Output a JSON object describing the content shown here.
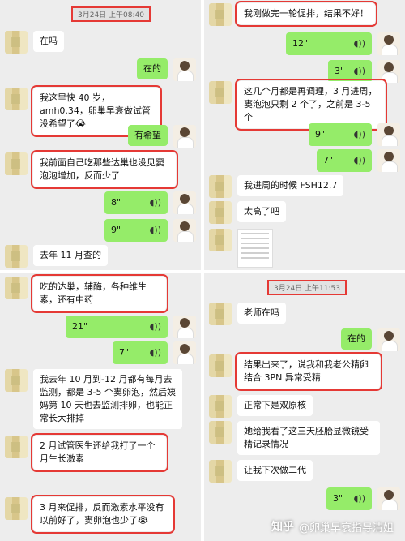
{
  "panel1": {
    "timestamp": "3月24日 上午08:40",
    "messages": [
      {
        "text": "在吗"
      },
      {
        "text": "在的"
      },
      {
        "text": "我这里快 40 岁，amh0.34，卵巢早衰做试管没希望了😭"
      },
      {
        "text": "有希望"
      },
      {
        "text": "我前面自己吃那些达巢也没见窦泡泡增加，反而少了"
      },
      {
        "duration": "8\"",
        "icon": "voice-wave-icon"
      },
      {
        "duration": "9\"",
        "icon": "voice-wave-icon"
      },
      {
        "text": "去年 11 月查的"
      }
    ]
  },
  "panel2": {
    "messages": [
      {
        "text": "我刚做完一轮促排，结果不好！"
      },
      {
        "duration": "12\""
      },
      {
        "duration": "3\""
      },
      {
        "text": "这几个月都是再调理，3 月进周，窦泡泡只剩 2 个了，之前是 3-5 个"
      },
      {
        "duration": "9\""
      },
      {
        "duration": "7\""
      },
      {
        "text": "我进周的时候 FSH12.7"
      },
      {
        "text": "太高了吧"
      }
    ]
  },
  "panel3": {
    "messages": [
      {
        "text": "吃的达巢，辅酶，各种维生素，还有中药"
      },
      {
        "duration": "21\""
      },
      {
        "duration": "7\""
      },
      {
        "text": "我去年 10 月到-12 月都有每月去监测，都是 3-5 个窦卵泡，然后姨妈第 10 天也去监测排卵，也能正常长大排掉"
      },
      {
        "text": "2 月试管医生还给我打了一个月生长激素"
      },
      {
        "text": "3 月来促排，反而激素水平没有以前好了，窦卵泡也少了😭"
      }
    ]
  },
  "panel4": {
    "timestamp": "3月24日 上午11:53",
    "messages": [
      {
        "text": "老师在吗"
      },
      {
        "text": "在的"
      },
      {
        "text": "结果出来了，说我和我老公精卵结合 3PN 异常受精"
      },
      {
        "text": "正常下是双原核"
      },
      {
        "text": "她给我看了这三天胚胎显微镜受精记录情况"
      },
      {
        "text": "让我下次做二代"
      },
      {
        "duration": "3\""
      }
    ]
  },
  "watermark": {
    "brand": "知乎",
    "author": "@卵巢早衰指导清姐"
  },
  "colors": {
    "green_bubble": "#95ec69",
    "highlight": "#e53935",
    "chat_bg": "#ededed"
  }
}
